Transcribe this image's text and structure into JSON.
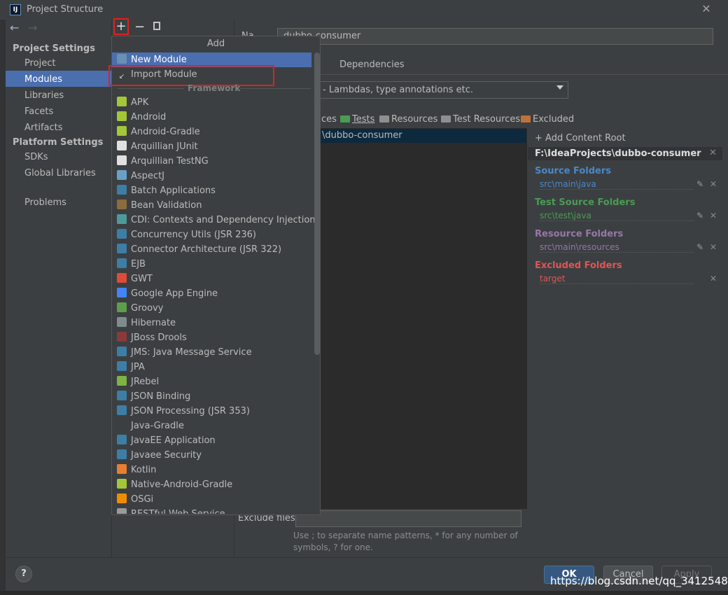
{
  "window": {
    "title": "Project Structure",
    "app_icon_label": "IJ"
  },
  "nav": {
    "back": "←",
    "forward": "→"
  },
  "sidebar": {
    "project_settings_header": "Project Settings",
    "items": [
      "Project",
      "Modules",
      "Libraries",
      "Facets",
      "Artifacts"
    ],
    "platform_settings_header": "Platform Settings",
    "platform_items": [
      "SDKs",
      "Global Libraries"
    ],
    "problems": "Problems",
    "selected": "Modules"
  },
  "toolbar": {
    "add": "+",
    "remove": "−"
  },
  "main": {
    "name_label": "Na",
    "name_value": "dubbo-consumer",
    "tab_dependencies": "Dependencies",
    "language_level": "- Lambdas, type annotations etc.",
    "mark_as": [
      "ces",
      "Tests",
      "Resources",
      "Test Resources",
      "Excluded"
    ],
    "tree_root": "\\dubbo-consumer",
    "add_content_root": "+ Add Content Root",
    "content_root_path": "F:\\IdeaProjects\\dubbo-consumer",
    "folders": [
      {
        "title": "Source Folders",
        "path": "src\\main\\java",
        "color": "#4a88c7"
      },
      {
        "title": "Test Source Folders",
        "path": "src\\test\\java",
        "color": "#499c54"
      },
      {
        "title": "Resource Folders",
        "path": "src\\main\\resources",
        "color": "#9876aa"
      },
      {
        "title": "Excluded Folders",
        "path": "target",
        "color": "#e05555"
      }
    ],
    "exclude_files_label": "Exclude files:",
    "hint": "Use ; to separate name patterns, * for any number of symbols, ? for one."
  },
  "popup": {
    "title": "Add",
    "new_module": "New Module",
    "import_module": "Import Module",
    "framework_header": "Framework",
    "frameworks": [
      {
        "label": "APK",
        "icon": "android-icon",
        "color": "#a4c639"
      },
      {
        "label": "Android",
        "icon": "android-icon",
        "color": "#a4c639"
      },
      {
        "label": "Android-Gradle",
        "icon": "android-icon",
        "color": "#a4c639"
      },
      {
        "label": "Arquillian JUnit",
        "icon": "alien-icon",
        "color": "#e0e0e0"
      },
      {
        "label": "Arquillian TestNG",
        "icon": "alien-icon",
        "color": "#e0e0e0"
      },
      {
        "label": "AspectJ",
        "icon": "aspectj-icon",
        "color": "#6aa0c8"
      },
      {
        "label": "Batch Applications",
        "icon": "javaee-icon",
        "color": "#3d7ea6"
      },
      {
        "label": "Bean Validation",
        "icon": "bean-icon",
        "color": "#8a6d3b"
      },
      {
        "label": "CDI: Contexts and Dependency Injection",
        "icon": "cdi-icon",
        "color": "#4e9a9a"
      },
      {
        "label": "Concurrency Utils (JSR 236)",
        "icon": "javaee-icon",
        "color": "#3d7ea6"
      },
      {
        "label": "Connector Architecture (JSR 322)",
        "icon": "javaee-icon",
        "color": "#3d7ea6"
      },
      {
        "label": "EJB",
        "icon": "javaee-icon",
        "color": "#3d7ea6"
      },
      {
        "label": "GWT",
        "icon": "google-icon",
        "color": "#dd4b39"
      },
      {
        "label": "Google App Engine",
        "icon": "appengine-icon",
        "color": "#4285f4"
      },
      {
        "label": "Groovy",
        "icon": "groovy-icon",
        "color": "#5e9e4a"
      },
      {
        "label": "Hibernate",
        "icon": "hibernate-icon",
        "color": "#7f8c8d"
      },
      {
        "label": "JBoss Drools",
        "icon": "drools-icon",
        "color": "#8b3a3a"
      },
      {
        "label": "JMS: Java Message Service",
        "icon": "javaee-icon",
        "color": "#3d7ea6"
      },
      {
        "label": "JPA",
        "icon": "jpa-icon",
        "color": "#3d7ea6"
      },
      {
        "label": "JRebel",
        "icon": "jrebel-icon",
        "color": "#7cb342"
      },
      {
        "label": "JSON Binding",
        "icon": "javaee-icon",
        "color": "#3d7ea6"
      },
      {
        "label": "JSON Processing (JSR 353)",
        "icon": "javaee-icon",
        "color": "#3d7ea6"
      },
      {
        "label": "Java-Gradle",
        "icon": "none",
        "color": ""
      },
      {
        "label": "JavaEE Application",
        "icon": "javaee-app-icon",
        "color": "#3d7ea6"
      },
      {
        "label": "Javaee Security",
        "icon": "javaee-icon",
        "color": "#3d7ea6"
      },
      {
        "label": "Kotlin",
        "icon": "kotlin-icon",
        "color": "#e87e32"
      },
      {
        "label": "Native-Android-Gradle",
        "icon": "android-icon",
        "color": "#a4c639"
      },
      {
        "label": "OSGi",
        "icon": "osgi-icon",
        "color": "#f08c00"
      },
      {
        "label": "RESTful Web Service",
        "icon": "rest-icon",
        "color": "#9a9a9a"
      }
    ]
  },
  "buttons": {
    "help": "?",
    "ok": "OK",
    "cancel": "Cancel",
    "apply": "Apply"
  },
  "watermark": "https://blog.csdn.net/qq_34125483"
}
